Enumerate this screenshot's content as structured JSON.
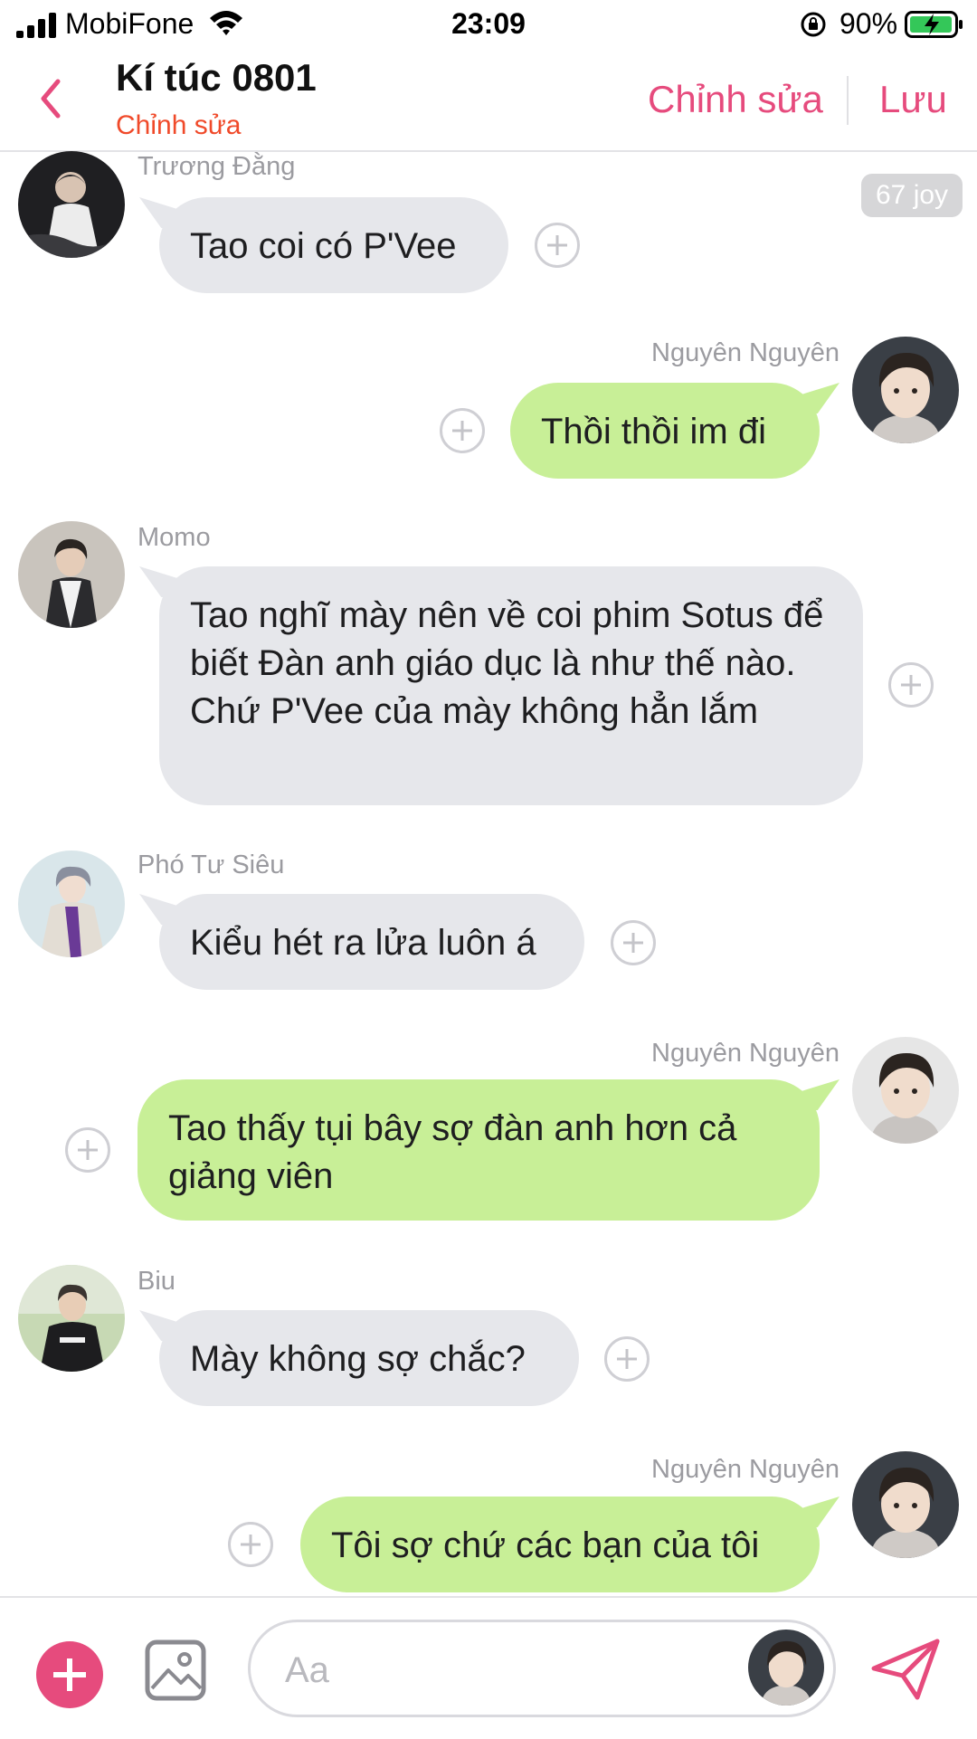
{
  "status_bar": {
    "carrier": "MobiFone",
    "time": "23:09",
    "battery": "90%"
  },
  "header": {
    "title": "Kí túc 0801",
    "subtitle": "Chỉnh sửa",
    "edit_label": "Chỉnh sửa",
    "save_label": "Lưu"
  },
  "joy_badge": "67 joy",
  "messages": [
    {
      "sender": "Trương Đằng",
      "text": "Tao coi có P'Vee",
      "side": "left"
    },
    {
      "sender": "Nguyên Nguyên",
      "text": "Thồi thồi im đi",
      "side": "right"
    },
    {
      "sender": "Momo",
      "text": "Tao nghĩ mày nên về coi phim  Sotus để biết Đàn anh giáo dục là như thế nào. Chứ P'Vee của mày không hẳn lắm",
      "side": "left"
    },
    {
      "sender": "Phó Tư Siêu",
      "text": "Kiểu hét ra lửa luôn á",
      "side": "left"
    },
    {
      "sender": "Nguyên Nguyên",
      "text": "Tao thấy tụi bây sợ đàn anh hơn cả giảng viên",
      "side": "right"
    },
    {
      "sender": "Biu",
      "text": "Mày không sợ chắc?",
      "side": "left"
    },
    {
      "sender": "Nguyên Nguyên",
      "text": "Tôi sợ chứ các bạn của tôi",
      "side": "right"
    }
  ],
  "composer": {
    "placeholder": "Aa"
  },
  "icons": {
    "back": "chevron-left-icon",
    "add": "plus-icon",
    "image": "image-icon",
    "send": "send-icon",
    "react": "add-reaction-icon"
  },
  "colors": {
    "accent": "#e64b7d",
    "subtitle": "#f04a2a",
    "incoming_bubble": "#e6e7eb",
    "outgoing_bubble": "#c8ef97",
    "sender_name": "#9b9ba0"
  }
}
